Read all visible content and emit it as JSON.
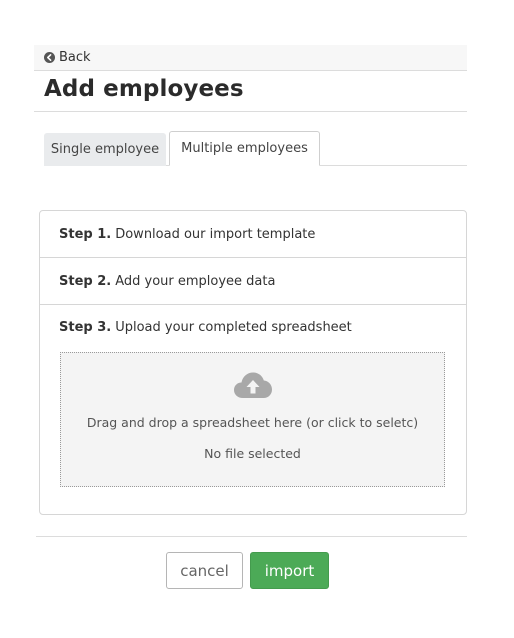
{
  "nav": {
    "back_label": "Back",
    "back_icon": "arrow-circle-left-icon"
  },
  "page": {
    "title": "Add employees"
  },
  "tabs": [
    {
      "label": "Single employee",
      "active": false
    },
    {
      "label": "Multiple employees",
      "active": true
    }
  ],
  "steps": [
    {
      "number": "Step 1.",
      "text": "Download our import template"
    },
    {
      "number": "Step 2.",
      "text": "Add your employee data"
    },
    {
      "number": "Step 3.",
      "text": "Upload your completed spreadsheet"
    }
  ],
  "upload": {
    "icon": "cloud-upload-icon",
    "drop_text": "Drag and drop a spreadsheet here (or click to seletc)",
    "file_status": "No file selected"
  },
  "actions": {
    "cancel_label": "cancel",
    "import_label": "import"
  },
  "colors": {
    "primary_green": "#4caa57",
    "tab_inactive_bg": "#e9ebed",
    "dropzone_bg": "#f4f4f4",
    "icon_gray": "#a8a8a8",
    "border_gray": "#d6d6d6"
  }
}
